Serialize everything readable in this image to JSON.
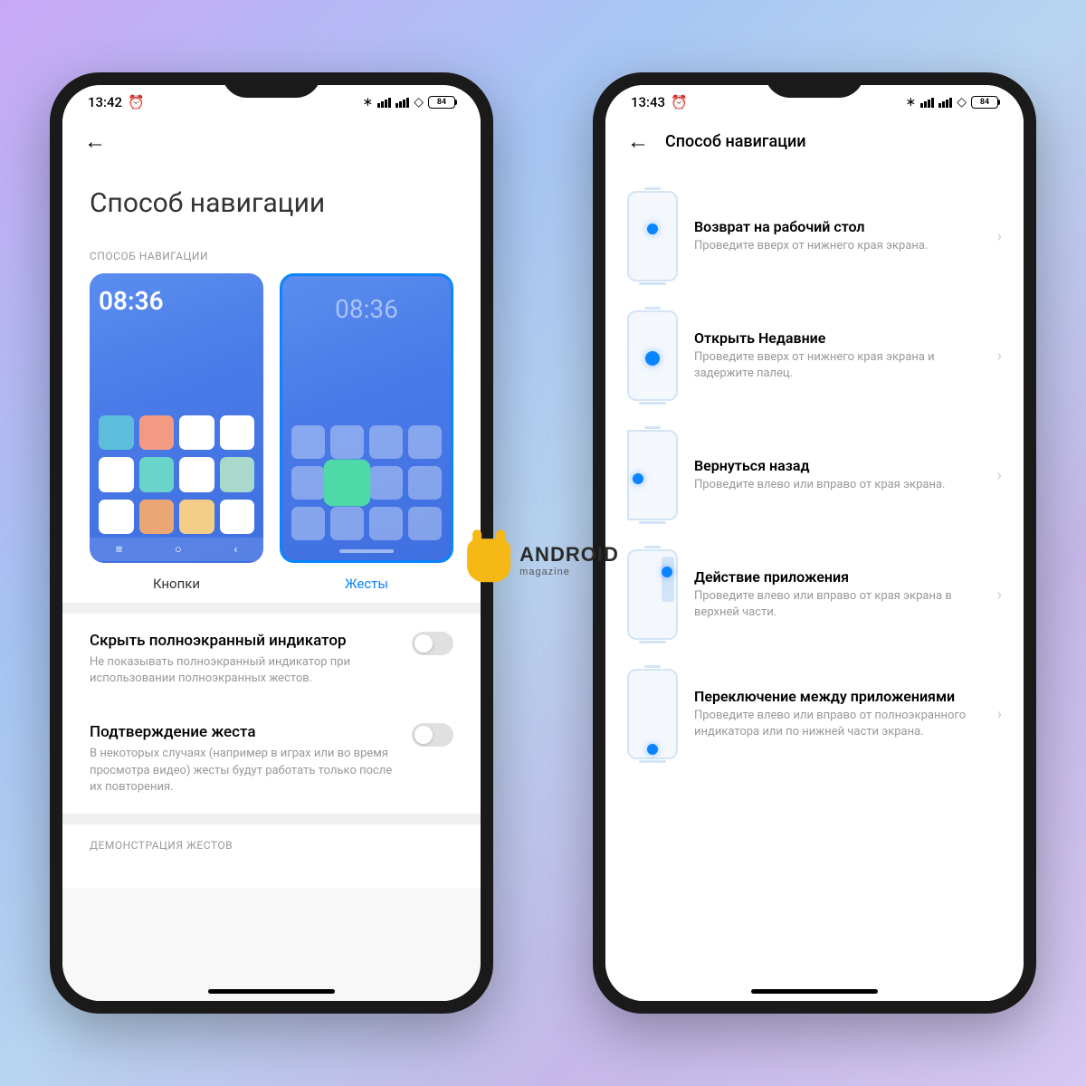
{
  "watermark": {
    "main": "ANDROID",
    "sub": "magazine"
  },
  "phone1": {
    "status": {
      "time": "13:42",
      "battery": "84"
    },
    "pageTitle": "Способ навигации",
    "sectionLabel": "СПОСОБ НАВИГАЦИИ",
    "previewTime": "08:36",
    "opt1": "Кнопки",
    "opt2": "Жесты",
    "setting1": {
      "title": "Скрыть полноэкранный индикатор",
      "desc": "Не показывать полноэкранный индикатор при использовании полноэкранных жестов."
    },
    "setting2": {
      "title": "Подтверждение жеста",
      "desc": "В некоторых случаях (например в играх или во время просмотра видео) жесты будут работать только после их повторения."
    },
    "demoLabel": "ДЕМОНСТРАЦИЯ ЖЕСТОВ"
  },
  "phone2": {
    "status": {
      "time": "13:43",
      "battery": "84"
    },
    "headerTitle": "Способ навигации",
    "g1": {
      "title": "Возврат на рабочий стол",
      "desc": "Проведите вверх от нижнего края экрана."
    },
    "g2": {
      "title": "Открыть Недавние",
      "desc": "Проведите вверх от нижнего края экрана и задержите палец."
    },
    "g3": {
      "title": "Вернуться назад",
      "desc": "Проведите влево или вправо от края экрана."
    },
    "g4": {
      "title": "Действие приложения",
      "desc": "Проведите влево или вправо от края экрана в верхней части."
    },
    "g5": {
      "title": "Переключение между приложениями",
      "desc": "Проведите влево или вправо от полноэкранного индикатора или по нижней части экрана."
    }
  }
}
